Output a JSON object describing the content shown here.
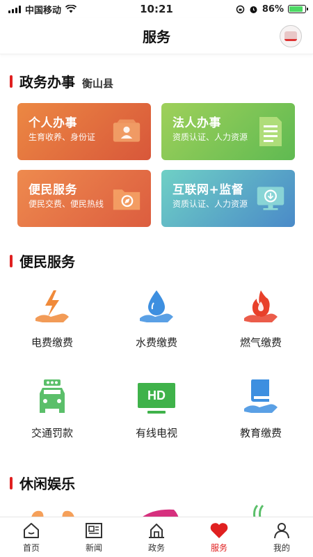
{
  "status_bar": {
    "carrier": "中国移动",
    "time": "10:21",
    "battery_percent": "86%",
    "battery_level": 0.86
  },
  "header": {
    "title": "服务"
  },
  "gov_section": {
    "title": "政务办事",
    "subtitle": "衡山县",
    "cards": [
      {
        "title": "个人办事",
        "desc": "生育收养、身份证",
        "icon": "person-card-icon"
      },
      {
        "title": "法人办事",
        "desc": "资质认证、人力资源",
        "icon": "document-icon"
      },
      {
        "title": "便民服务",
        "desc": "便民交费、便民热线",
        "icon": "folder-compass-icon"
      },
      {
        "title": "互联网+监督",
        "desc": "资质认证、人力资源",
        "icon": "monitor-icon"
      }
    ]
  },
  "convenience_section": {
    "title": "便民服务",
    "items": [
      {
        "label": "电费缴费",
        "icon": "electricity-icon"
      },
      {
        "label": "水费缴费",
        "icon": "water-drop-icon"
      },
      {
        "label": "燃气缴费",
        "icon": "gas-flame-icon"
      },
      {
        "label": "交通罚款",
        "icon": "traffic-car-icon"
      },
      {
        "label": "有线电视",
        "icon": "hd-tv-icon"
      },
      {
        "label": "教育缴费",
        "icon": "education-book-icon"
      }
    ],
    "hd_text": "HD"
  },
  "leisure_section": {
    "title": "休闲娱乐"
  },
  "tabbar": {
    "tabs": [
      {
        "label": "首页",
        "icon": "home-icon"
      },
      {
        "label": "新闻",
        "icon": "news-icon"
      },
      {
        "label": "政务",
        "icon": "government-icon"
      },
      {
        "label": "服务",
        "icon": "heart-icon"
      },
      {
        "label": "我的",
        "icon": "user-icon"
      }
    ],
    "active": "服务"
  },
  "colors": {
    "accent": "#e02020",
    "icon_orange": "#f08a3a",
    "icon_blue": "#3d8fe0",
    "icon_red": "#e8402a",
    "icon_green": "#5bbf6a"
  }
}
